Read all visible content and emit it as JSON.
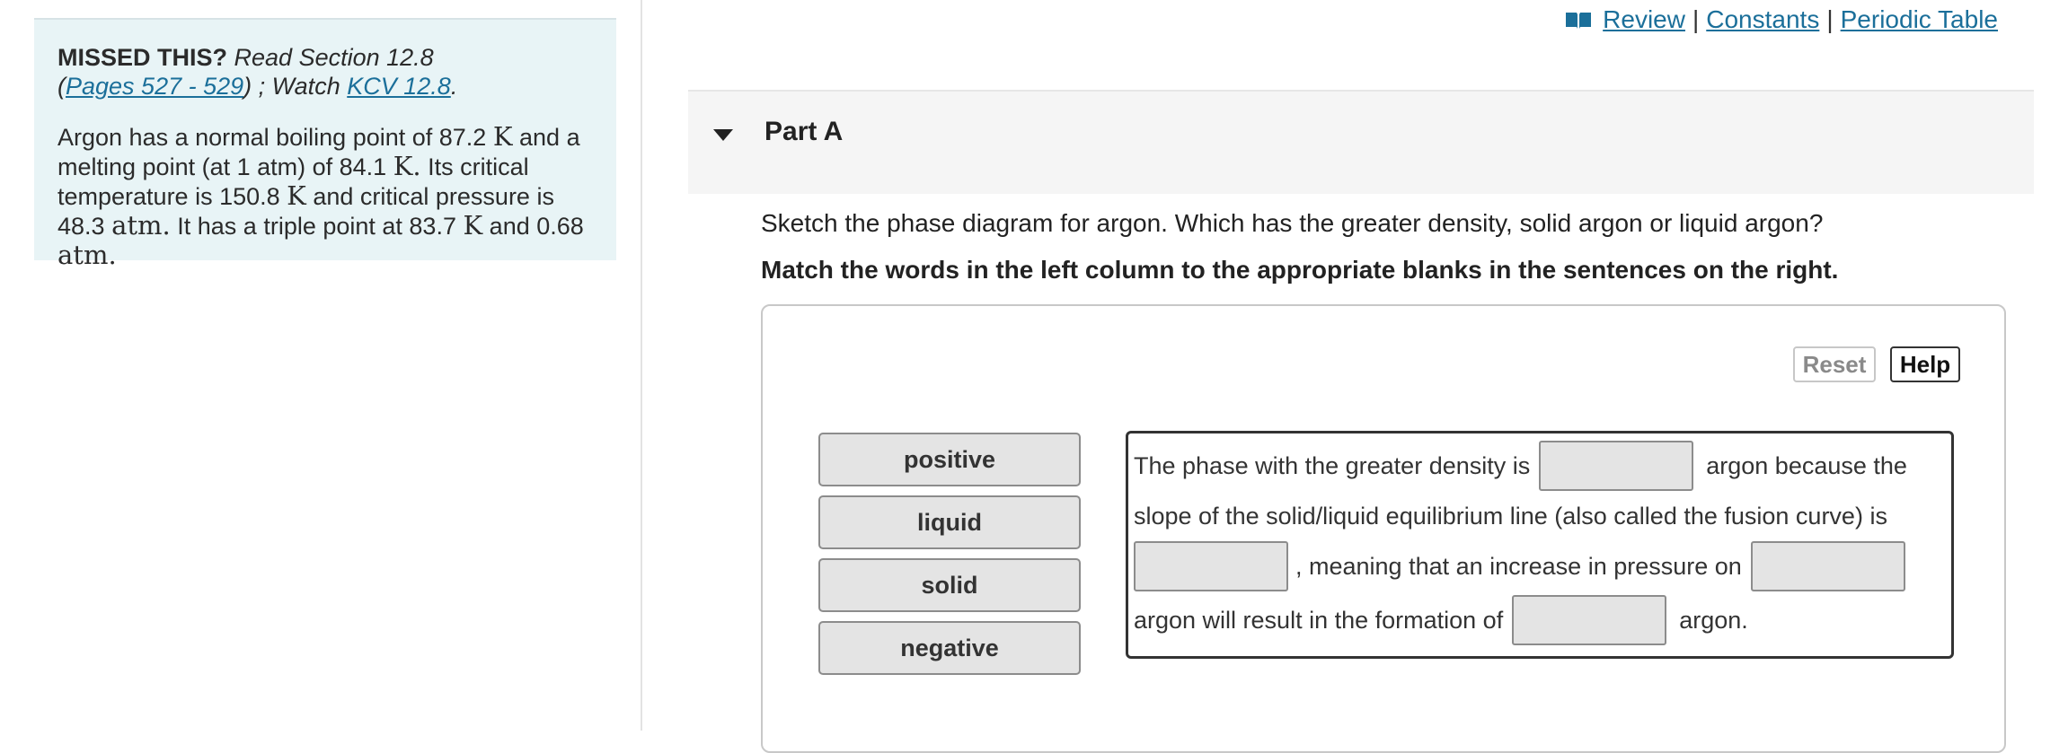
{
  "sidebar": {
    "missed_label": "MISSED THIS?",
    "read_text": "Read Section 12.8",
    "pages_link": "Pages 527 - 529",
    "watch_text": "; Watch",
    "kcv_link": "KCV 12.8",
    "problem": {
      "t1": "Argon has a normal boiling point of 87.2",
      "u1": "K",
      "t2": "and a melting point (at 1 atm) of 84.1",
      "u2": "K.",
      "t3": "Its critical temperature is 150.8",
      "u3": "K",
      "t4": "and critical pressure is 48.3",
      "u4": "atm.",
      "t5": "It has a triple point at 83.7",
      "u5": "K",
      "t6": "and 0.68",
      "u6": "atm."
    }
  },
  "top_links": {
    "review": "Review",
    "separator": "|",
    "constants": "Constants",
    "periodic_table": "Periodic Table"
  },
  "part": {
    "title": "Part A"
  },
  "question": "Sketch the phase diagram for argon. Which has the greater density, solid argon or liquid argon?",
  "instruction": "Match the words in the left column to the appropriate blanks in the sentences on the right.",
  "buttons": {
    "reset": "Reset",
    "help": "Help"
  },
  "word_bank": [
    "positive",
    "liquid",
    "solid",
    "negative"
  ],
  "sentences": {
    "l1_a": "The phase with the greater density is",
    "l1_b": "argon because the",
    "l2": "slope of the solid/liquid equilibrium line (also called the fusion curve) is",
    "l3_a": ", meaning that an increase in pressure on",
    "l4_a": "argon will result in the formation of",
    "l4_b": "argon."
  },
  "colors": {
    "link": "#1b6f9a",
    "sidebar_bg": "#e8f4f6",
    "chip_bg": "#e4e4e4"
  }
}
